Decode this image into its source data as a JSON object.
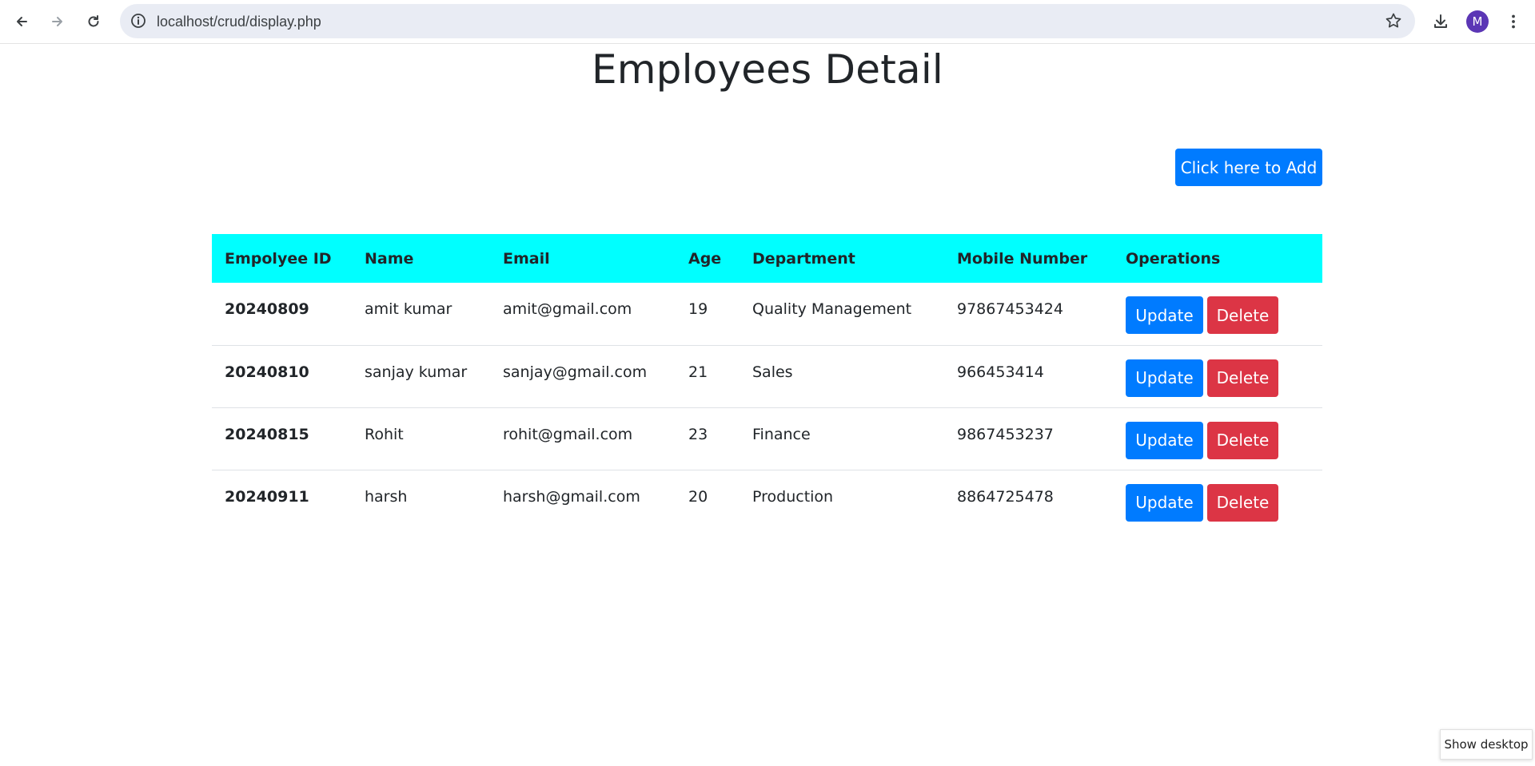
{
  "browser": {
    "url": "localhost/crud/display.php",
    "avatar_letter": "M",
    "icons": {
      "back": "arrow-left-icon",
      "forward": "arrow-right-icon",
      "reload": "reload-icon",
      "site_info": "info-icon",
      "bookmark": "star-icon",
      "download": "download-icon",
      "menu": "kebab-menu-icon"
    }
  },
  "page": {
    "title": "Employees Detail",
    "add_button": "Click here to Add"
  },
  "table": {
    "headers": [
      "Empolyee ID",
      "Name",
      "Email",
      "Age",
      "Department",
      "Mobile Number",
      "Operations"
    ],
    "rows": [
      {
        "id": "20240809",
        "name": "amit kumar",
        "email": "amit@gmail.com",
        "age": "19",
        "department": "Quality Management",
        "mobile": "97867453424"
      },
      {
        "id": "20240810",
        "name": "sanjay kumar",
        "email": "sanjay@gmail.com",
        "age": "21",
        "department": "Sales",
        "mobile": "966453414"
      },
      {
        "id": "20240815",
        "name": "Rohit",
        "email": "rohit@gmail.com",
        "age": "23",
        "department": "Finance",
        "mobile": "9867453237"
      },
      {
        "id": "20240911",
        "name": "harsh",
        "email": "harsh@gmail.com",
        "age": "20",
        "department": "Production",
        "mobile": "8864725478"
      }
    ],
    "update_label": "Update",
    "delete_label": "Delete"
  },
  "taskbar": {
    "show_desktop": "Show desktop"
  },
  "colors": {
    "header_bg": "#00ffff",
    "primary": "#007bff",
    "danger": "#dc3545"
  }
}
